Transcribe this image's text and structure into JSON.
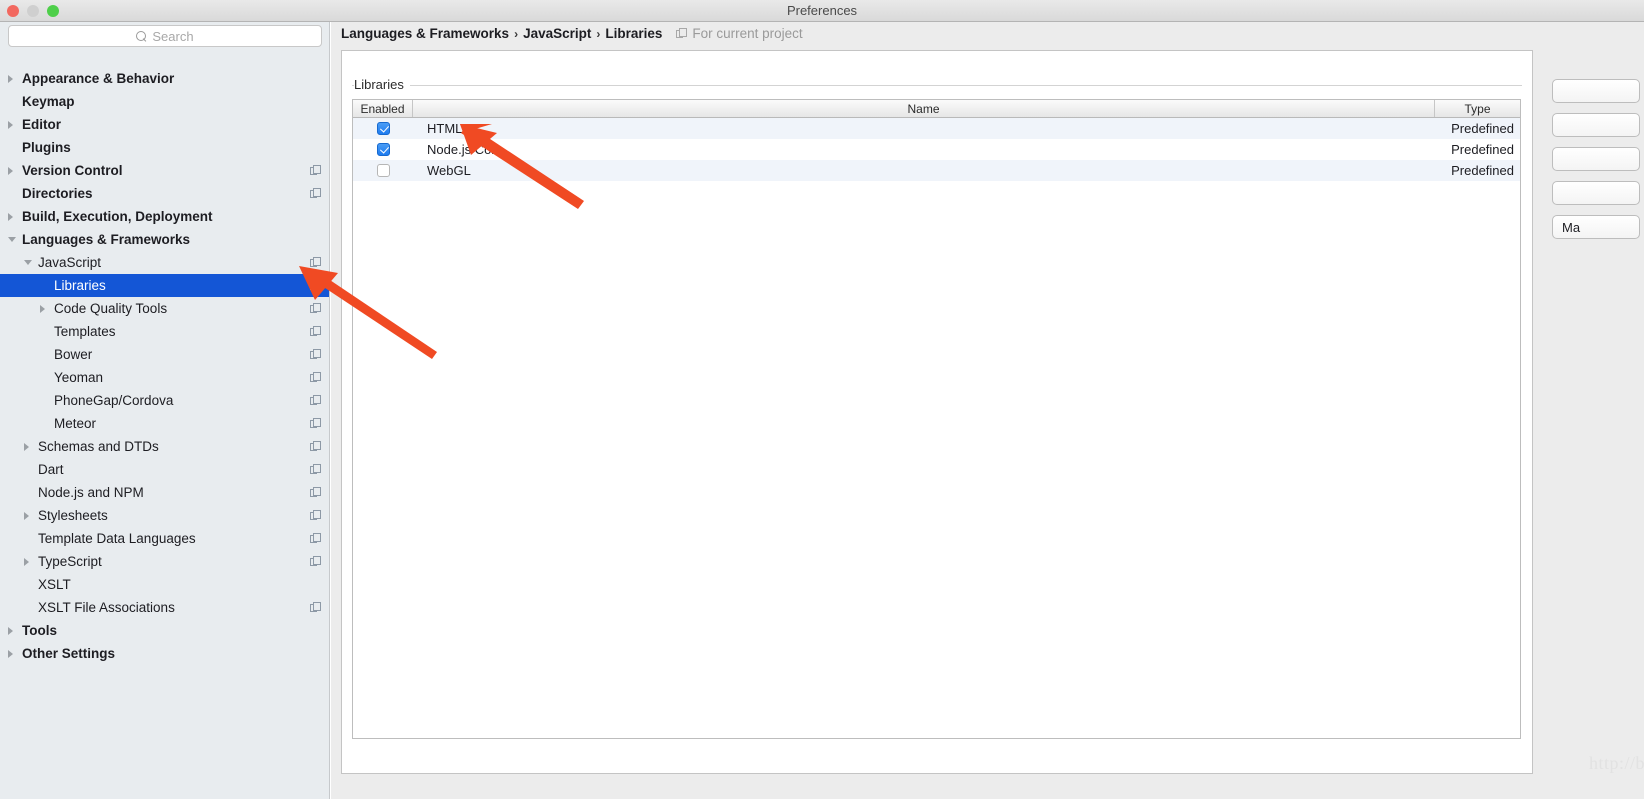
{
  "window": {
    "title": "Preferences",
    "controls": [
      "close",
      "minimize",
      "zoom"
    ]
  },
  "sidebar": {
    "search": {
      "placeholder": "Search",
      "value": "",
      "icon": "search-icon"
    },
    "items": [
      {
        "label": "Appearance & Behavior",
        "level": 0,
        "bold": true,
        "arrow": "right",
        "project_icon": false,
        "selected": false
      },
      {
        "label": "Keymap",
        "level": 0,
        "bold": true,
        "arrow": "none",
        "project_icon": false,
        "selected": false
      },
      {
        "label": "Editor",
        "level": 0,
        "bold": true,
        "arrow": "right",
        "project_icon": false,
        "selected": false
      },
      {
        "label": "Plugins",
        "level": 0,
        "bold": true,
        "arrow": "none",
        "project_icon": false,
        "selected": false
      },
      {
        "label": "Version Control",
        "level": 0,
        "bold": true,
        "arrow": "right",
        "project_icon": true,
        "selected": false
      },
      {
        "label": "Directories",
        "level": 0,
        "bold": true,
        "arrow": "none",
        "project_icon": true,
        "selected": false
      },
      {
        "label": "Build, Execution, Deployment",
        "level": 0,
        "bold": true,
        "arrow": "right",
        "project_icon": false,
        "selected": false
      },
      {
        "label": "Languages & Frameworks",
        "level": 0,
        "bold": true,
        "arrow": "down",
        "project_icon": false,
        "selected": false
      },
      {
        "label": "JavaScript",
        "level": 1,
        "bold": false,
        "arrow": "down",
        "project_icon": true,
        "selected": false
      },
      {
        "label": "Libraries",
        "level": 2,
        "bold": false,
        "arrow": "none",
        "project_icon": true,
        "selected": true
      },
      {
        "label": "Code Quality Tools",
        "level": 2,
        "bold": false,
        "arrow": "right",
        "project_icon": true,
        "selected": false
      },
      {
        "label": "Templates",
        "level": 2,
        "bold": false,
        "arrow": "none",
        "project_icon": true,
        "selected": false
      },
      {
        "label": "Bower",
        "level": 2,
        "bold": false,
        "arrow": "none",
        "project_icon": true,
        "selected": false
      },
      {
        "label": "Yeoman",
        "level": 2,
        "bold": false,
        "arrow": "none",
        "project_icon": true,
        "selected": false
      },
      {
        "label": "PhoneGap/Cordova",
        "level": 2,
        "bold": false,
        "arrow": "none",
        "project_icon": true,
        "selected": false
      },
      {
        "label": "Meteor",
        "level": 2,
        "bold": false,
        "arrow": "none",
        "project_icon": true,
        "selected": false
      },
      {
        "label": "Schemas and DTDs",
        "level": 1,
        "bold": false,
        "arrow": "right",
        "project_icon": true,
        "selected": false
      },
      {
        "label": "Dart",
        "level": 1,
        "bold": false,
        "arrow": "none",
        "project_icon": true,
        "selected": false
      },
      {
        "label": "Node.js and NPM",
        "level": 1,
        "bold": false,
        "arrow": "none",
        "project_icon": true,
        "selected": false
      },
      {
        "label": "Stylesheets",
        "level": 1,
        "bold": false,
        "arrow": "right",
        "project_icon": true,
        "selected": false
      },
      {
        "label": "Template Data Languages",
        "level": 1,
        "bold": false,
        "arrow": "none",
        "project_icon": true,
        "selected": false
      },
      {
        "label": "TypeScript",
        "level": 1,
        "bold": false,
        "arrow": "right",
        "project_icon": true,
        "selected": false
      },
      {
        "label": "XSLT",
        "level": 1,
        "bold": false,
        "arrow": "none",
        "project_icon": false,
        "selected": false
      },
      {
        "label": "XSLT File Associations",
        "level": 1,
        "bold": false,
        "arrow": "none",
        "project_icon": true,
        "selected": false
      },
      {
        "label": "Tools",
        "level": 0,
        "bold": true,
        "arrow": "right",
        "project_icon": false,
        "selected": false
      },
      {
        "label": "Other Settings",
        "level": 0,
        "bold": true,
        "arrow": "right",
        "project_icon": false,
        "selected": false
      }
    ]
  },
  "content": {
    "breadcrumb": {
      "parts": [
        "Languages & Frameworks",
        "JavaScript",
        "Libraries"
      ],
      "separator": "›",
      "scope_note": "For current project",
      "scope_icon": "project-scope-icon"
    },
    "group_label": "Libraries",
    "table": {
      "columns": [
        "Enabled",
        "Name",
        "Type"
      ],
      "rows": [
        {
          "enabled": true,
          "name": "HTML",
          "type": "Predefined"
        },
        {
          "enabled": true,
          "name": "Node.js Core",
          "type": "Predefined"
        },
        {
          "enabled": false,
          "name": "WebGL",
          "type": "Predefined"
        }
      ]
    },
    "side_buttons": [
      {
        "label": "",
        "name": "add-button"
      },
      {
        "label": "",
        "name": "edit-button"
      },
      {
        "label": "",
        "name": "remove-button"
      },
      {
        "label": "",
        "name": "download-button"
      },
      {
        "label": "Ma",
        "name": "manage-scopes-button"
      }
    ]
  },
  "annotations": {
    "arrows": [
      {
        "name": "arrow-to-node-js-core",
        "color": "#f04a23"
      },
      {
        "name": "arrow-to-libraries-item",
        "color": "#f04a23"
      }
    ]
  },
  "watermark": {
    "text": "http://blog.csdn.net/thatway_wp",
    "color": "#e2e2e2"
  }
}
